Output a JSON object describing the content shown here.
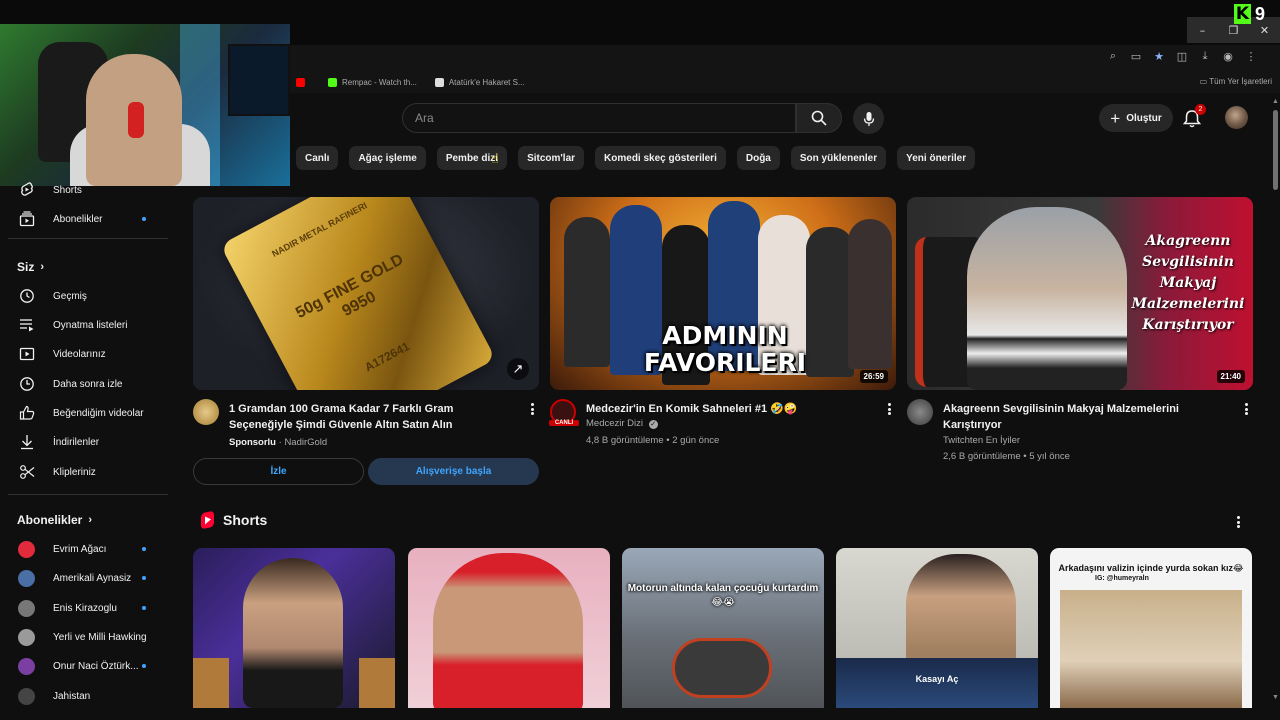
{
  "window": {
    "minimize": "–",
    "maximize": "❐",
    "close": "✕",
    "kick_letter": "K",
    "kick_count": "9"
  },
  "bookmarks": {
    "items": [
      {
        "label": "",
        "color": "#ff0000"
      },
      {
        "label": "Rempac - Watch th...",
        "color": "#53fc18"
      },
      {
        "label": "Atatürk'e Hakaret S...",
        "color": "#dddddd"
      }
    ],
    "all_label": "Tüm Yer İşaretleri"
  },
  "header": {
    "search_placeholder": "Ara",
    "create_label": "Oluştur",
    "notifications_count": "2"
  },
  "chips": [
    "Canlı",
    "Ağaç işleme",
    "Pembe dizi",
    "Sitcom'lar",
    "Komedi skeç gösterileri",
    "Doğa",
    "Son yüklenenler",
    "Yeni öneriler"
  ],
  "sidebar": {
    "top_items": [
      {
        "label": "Shorts"
      },
      {
        "label": "Abonelikler",
        "dot": true
      }
    ],
    "you_heading": "Siz",
    "you_items": [
      {
        "label": "Geçmiş"
      },
      {
        "label": "Oynatma listeleri"
      },
      {
        "label": "Videolarınız"
      },
      {
        "label": "Daha sonra izle"
      },
      {
        "label": "Beğendiğim videolar"
      },
      {
        "label": "İndirilenler"
      },
      {
        "label": "Klipleriniz"
      }
    ],
    "subs_heading": "Abonelikler",
    "subscriptions": [
      {
        "label": "Evrim Ağacı",
        "color": "#e02b3c"
      },
      {
        "label": "Amerikali Aynasiz",
        "color": "#4a6fa5"
      },
      {
        "label": "Enis Kirazoglu",
        "color": "#777777"
      },
      {
        "label": "Yerli ve Milli Hawking",
        "color": "#9a9a9a"
      },
      {
        "label": "Onur Naci Öztürk...",
        "color": "#7a3fa0"
      },
      {
        "label": "Jahistan",
        "color": "#444444"
      }
    ]
  },
  "videos": [
    {
      "title": "1 Gramdan 100 Grama Kadar 7 Farklı Gram Seçeneğiyle Şimdi Güvenle Altın Satın Alın",
      "sponsored": "Sponsorlu",
      "channel": "NadirGold",
      "buttons": {
        "watch": "İzle",
        "shop": "Alışverişe başla"
      },
      "bar_text": "50g FINE GOLD 9950",
      "brand": "NADIR METAL RAFINERI",
      "serial": "A172641"
    },
    {
      "title": "Medcezir'in En Komik Sahneleri #1 🤣🤪",
      "channel": "Medcezir Dizi",
      "views": "4,8 B görüntüleme",
      "age": "2 gün önce",
      "duration": "26:59",
      "overlay": "ADMININ FAVORILERI",
      "live_badge": "CANLI"
    },
    {
      "title": "Akagreenn Sevgilisinin Makyaj Malzemelerini Karıştırıyor",
      "channel": "Twitchten En İyiler",
      "views": "2,6 B görüntüleme",
      "age": "5 yıl önce",
      "duration": "21:40",
      "overlay": "Akagreenn Sevgilisinin Makyaj Malzemelerini Karıştırıyor"
    }
  ],
  "shorts": {
    "heading": "Shorts",
    "items": [
      {
        "caption": ""
      },
      {
        "caption": ""
      },
      {
        "caption": "Motorun altında kalan çocuğu kurtardım 😂😭"
      },
      {
        "caption": "",
        "sub": "Kasayı Aç"
      },
      {
        "caption": "Arkadaşını valizin içinde yurda sokan kız😂",
        "handle": "IG: @humeyraln"
      }
    ]
  }
}
